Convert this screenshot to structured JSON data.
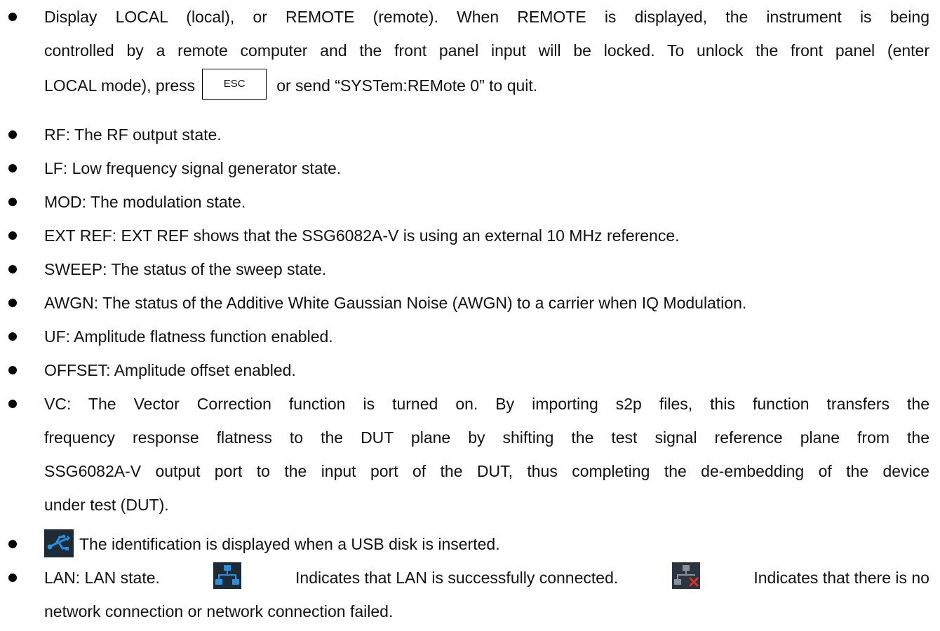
{
  "items": [
    {
      "lines": [
        "Display LOCAL (local), or REMOTE (remote). When REMOTE is displayed, the instrument is being",
        "controlled by a remote computer and the front panel input will be locked. To unlock the front panel (enter"
      ],
      "line3_before": "LOCAL mode), press",
      "key_label": "ESC",
      "line3_after": "or send “SYSTem:REMote 0” to quit."
    },
    {
      "text": "RF: The RF output state."
    },
    {
      "text": "LF: Low frequency signal generator state."
    },
    {
      "text": "MOD: The modulation state."
    },
    {
      "text": "EXT REF: EXT REF shows that the SSG6082A-V is using an external 10 MHz reference."
    },
    {
      "text": "SWEEP: The status of the sweep state."
    },
    {
      "text": "AWGN: The status of the Additive White Gaussian Noise (AWGN) to a carrier when IQ Modulation."
    },
    {
      "text": "UF: Amplitude flatness function enabled."
    },
    {
      "text": "OFFSET: Amplitude offset enabled."
    },
    {
      "lines": [
        "VC: The Vector Correction function is turned on. By importing s2p files, this function transfers the",
        "frequency response flatness to the DUT plane by shifting the test signal reference plane from the",
        "SSG6082A-V output port to the input port of the DUT, thus completing the de-embedding of the device",
        "under test (DUT)."
      ]
    },
    {
      "icon": "usb-icon",
      "text": "The identification is displayed when a USB disk is inserted."
    },
    {
      "prefix": "LAN: LAN state.",
      "icon_connected": "lan-connected-icon",
      "connected_text": "Indicates that LAN is successfully connected.",
      "icon_disconnected": "lan-disconnected-icon",
      "disconnected_text": "Indicates that there is no",
      "line2": "network connection or network connection failed."
    }
  ],
  "colors": {
    "text": "#111111",
    "icon_bg": "#1c2b36",
    "icon_blue": "#2a8fe0",
    "icon_red": "#e0302a"
  }
}
